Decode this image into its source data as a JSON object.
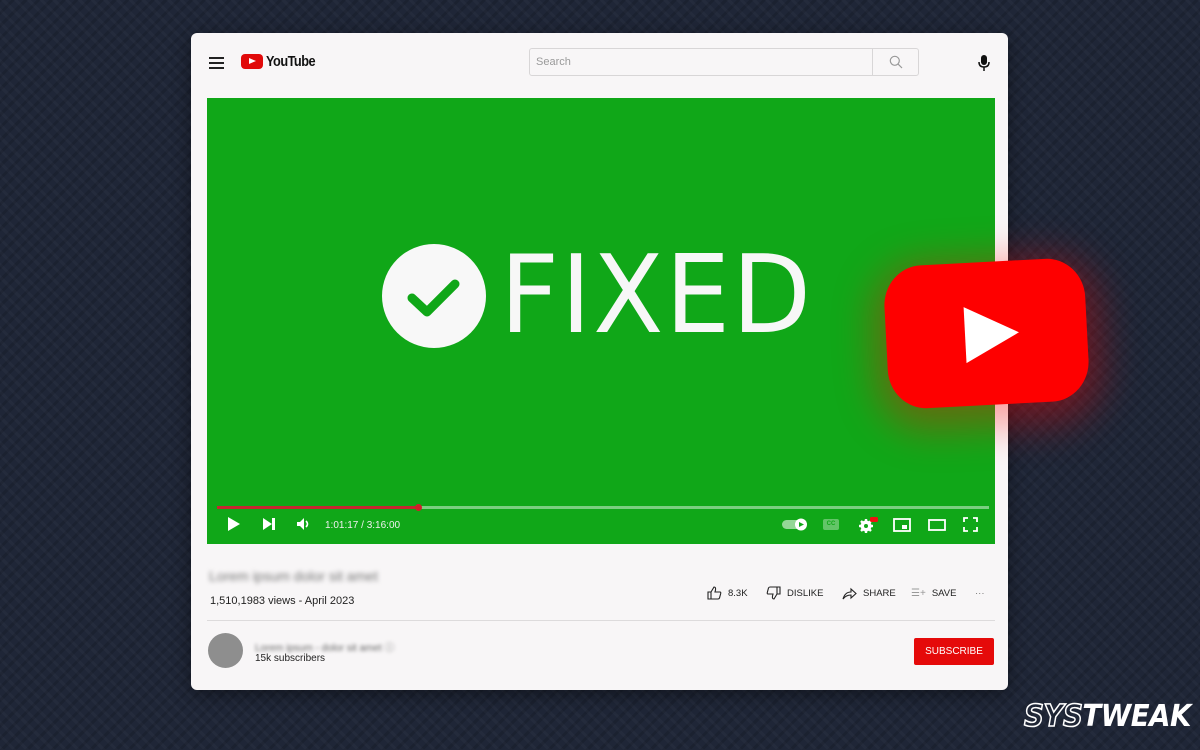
{
  "header": {
    "brand": "YouTube",
    "search_placeholder": "Search",
    "search_value": ""
  },
  "video": {
    "overlay_text": "FIXED",
    "background_color": "#10a718",
    "progress_fraction": 0.26,
    "time_current": "1:01:17",
    "time_total": "3:16:00",
    "time_display": "1:01:17 / 3:16:00",
    "settings_badge": "HD",
    "cc_label": "CC"
  },
  "info": {
    "title_blurred": "Lorem ipsum dolor sit amet",
    "views": "1,510,1983 views - April 2023",
    "like_count": "8.3K",
    "dislike_label": "DISLIKE",
    "share_label": "SHARE",
    "save_label": "SAVE",
    "more_label": "···"
  },
  "channel": {
    "name_blurred": "Lorem ipsum - dolor sit amet ⓘ",
    "subscribers": "15k subscribers",
    "subscribe_label": "SUBSCRIBE"
  },
  "branding": {
    "watermark_outline": "SYS",
    "watermark_solid": "TWEAK",
    "accent_red": "#e50a0a"
  }
}
